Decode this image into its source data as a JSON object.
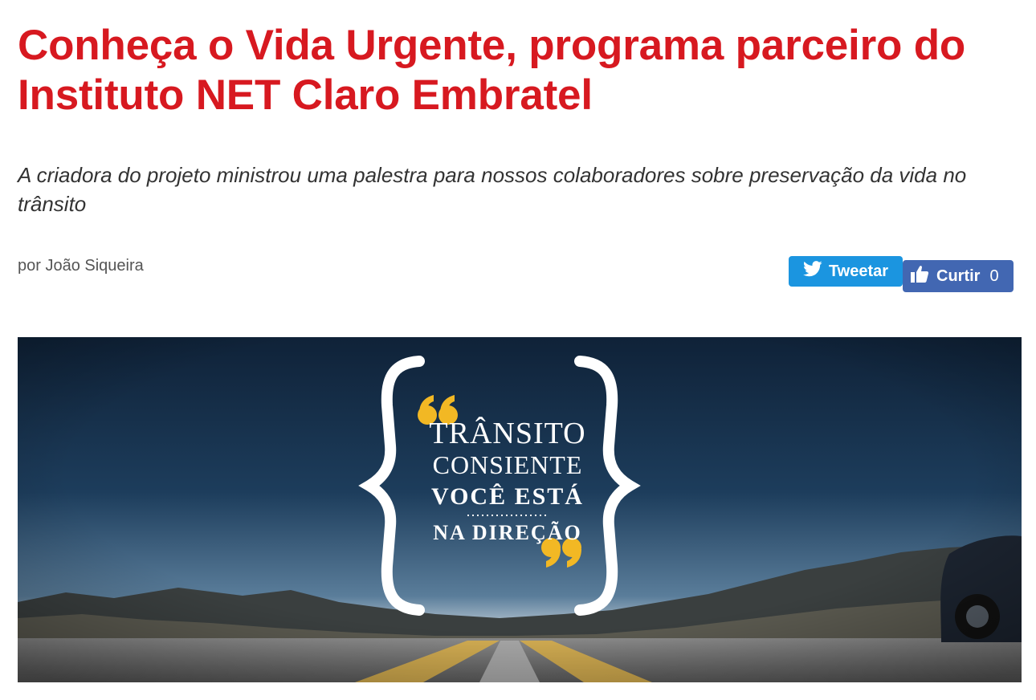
{
  "article": {
    "title": "Conheça o Vida Urgente, programa parceiro do Instituto NET Claro Embratel",
    "subtitle": "A criadora do projeto ministrou uma palestra para nossos colaboradores sobre preservação da vida no trânsito",
    "author": "por João Siqueira"
  },
  "social": {
    "tweet_label": "Tweetar",
    "like_label": "Curtir",
    "like_count": "0",
    "tweet_color": "#1b95e0",
    "like_color": "#4267b2"
  },
  "hero_image": {
    "line1": "TRÂNSITO",
    "line2": "CONSIENTE",
    "line3": "VOCÊ ESTÁ",
    "line4": "NA DIREÇÃO"
  },
  "colors": {
    "title": "#d71920",
    "quote_marks": "#f2b824"
  }
}
